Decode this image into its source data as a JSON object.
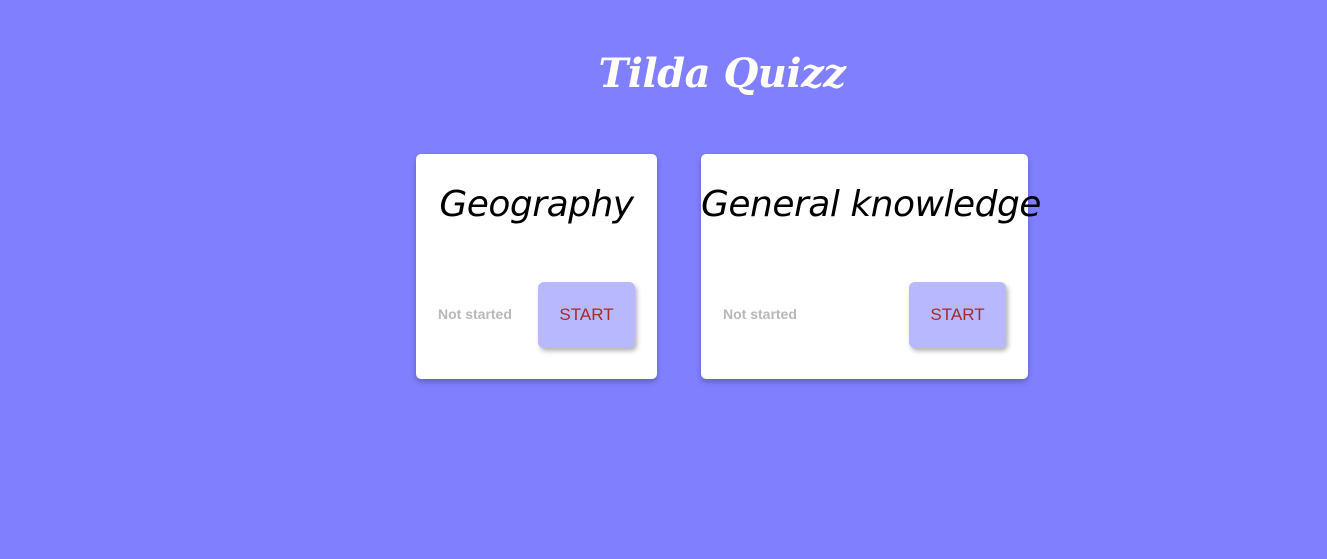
{
  "app": {
    "title": "Tilda Quizz"
  },
  "quizzes": [
    {
      "title": "Geography",
      "status": "Not started",
      "button_label": "START"
    },
    {
      "title": "General knowledge",
      "status": "Not started",
      "button_label": "START"
    }
  ],
  "colors": {
    "background": "#8080ff",
    "card": "#ffffff",
    "button": "#b8b8ff",
    "button_text": "#a52a2a",
    "status_text": "#b8b8b8"
  }
}
